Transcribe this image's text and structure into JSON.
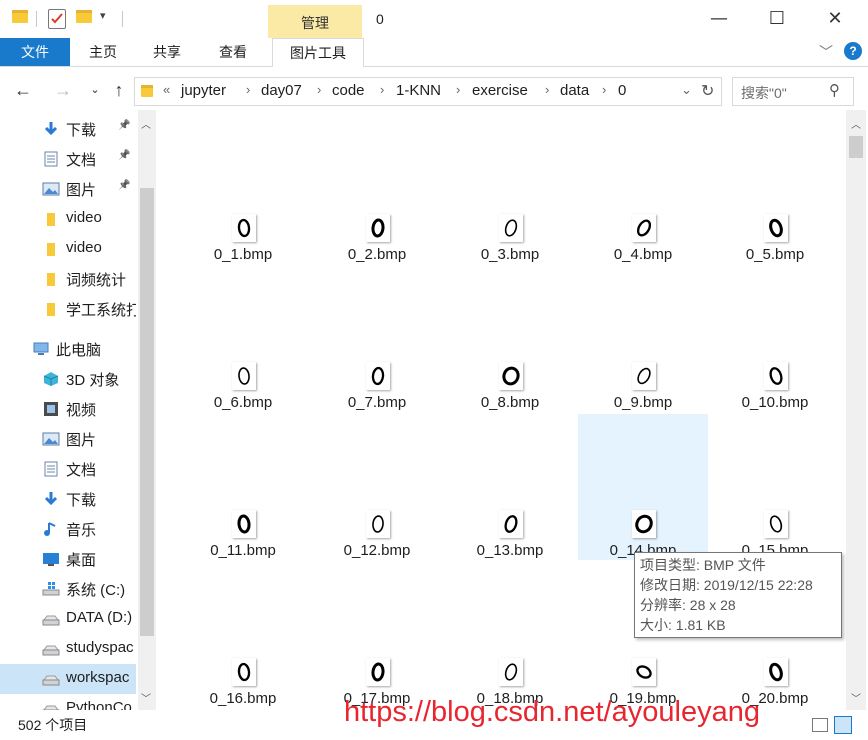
{
  "titlebar": {
    "manage_label": "管理",
    "title": "0",
    "minimize": "—",
    "maximize": "☐",
    "close": "✕"
  },
  "ribbon": {
    "tabs": [
      "文件",
      "主页",
      "共享",
      "查看",
      "图片工具"
    ]
  },
  "address": {
    "crumbs": [
      "jupyter",
      "day07",
      "code",
      "1-KNN",
      "exercise",
      "data",
      "0"
    ],
    "overflow": "«",
    "search_placeholder": "搜索\"0\""
  },
  "sidebar": {
    "items": [
      {
        "label": "下载",
        "icon": "download-arrow-icon",
        "pinned": true
      },
      {
        "label": "文档",
        "icon": "document-icon",
        "pinned": true
      },
      {
        "label": "图片",
        "icon": "picture-icon",
        "pinned": true
      },
      {
        "label": "video",
        "icon": "folder-icon",
        "pinned": false
      },
      {
        "label": "video",
        "icon": "folder-icon",
        "pinned": false
      },
      {
        "label": "词频统计",
        "icon": "folder-icon",
        "pinned": false
      },
      {
        "label": "学工系统打",
        "icon": "folder-icon",
        "pinned": false
      },
      {
        "label": "此电脑",
        "icon": "computer-icon",
        "pinned": false
      },
      {
        "label": "3D 对象",
        "icon": "3d-objects-icon",
        "pinned": false
      },
      {
        "label": "视频",
        "icon": "video-icon",
        "pinned": false
      },
      {
        "label": "图片",
        "icon": "picture-icon",
        "pinned": false
      },
      {
        "label": "文档",
        "icon": "document-icon",
        "pinned": false
      },
      {
        "label": "下载",
        "icon": "download-arrow-icon",
        "pinned": false
      },
      {
        "label": "音乐",
        "icon": "music-icon",
        "pinned": false
      },
      {
        "label": "桌面",
        "icon": "desktop-icon",
        "pinned": false
      },
      {
        "label": "系统 (C:)",
        "icon": "windows-drive-icon",
        "pinned": false
      },
      {
        "label": "DATA (D:)",
        "icon": "drive-icon",
        "pinned": false
      },
      {
        "label": "studyspac",
        "icon": "drive-icon",
        "pinned": false
      },
      {
        "label": "workspac",
        "icon": "drive-icon",
        "pinned": false
      },
      {
        "label": "PythonCo",
        "icon": "drive-icon",
        "pinned": false
      }
    ]
  },
  "files": [
    "0_1.bmp",
    "0_2.bmp",
    "0_3.bmp",
    "0_4.bmp",
    "0_5.bmp",
    "0_6.bmp",
    "0_7.bmp",
    "0_8.bmp",
    "0_9.bmp",
    "0_10.bmp",
    "0_11.bmp",
    "0_12.bmp",
    "0_13.bmp",
    "0_14.bmp",
    "0_15.bmp",
    "0_16.bmp",
    "0_17.bmp",
    "0_18.bmp",
    "0_19.bmp",
    "0_20.bmp"
  ],
  "tooltip": {
    "type": "项目类型: BMP 文件",
    "modified": "修改日期: 2019/12/15 22:28",
    "resolution": "分辨率: 28 x 28",
    "size": "大小: 1.81 KB"
  },
  "status": {
    "count": "502 个项目"
  },
  "watermark": "https://blog.csdn.net/ayouleyang",
  "colors": {
    "accent": "#1979ca",
    "manage_tab": "#fbe9a6",
    "hover": "#e5f3ff",
    "watermark": "#e8262f"
  }
}
